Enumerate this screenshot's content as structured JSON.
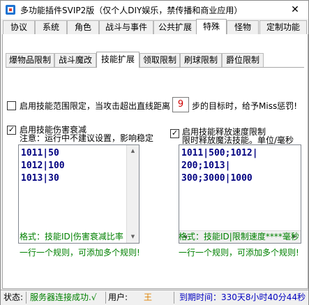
{
  "window": {
    "title": "多功能插件SVIP2版（仅个人DIY娱乐，禁传播和商业应用）",
    "close_label": "✕"
  },
  "main_tabs": [
    {
      "label": "协议"
    },
    {
      "label": "系统"
    },
    {
      "label": "角色"
    },
    {
      "label": "战斗与事件"
    },
    {
      "label": "公共扩展"
    },
    {
      "label": "特殊"
    },
    {
      "label": "怪物"
    },
    {
      "label": "定制功能"
    }
  ],
  "main_tab_active": "特殊",
  "sub_tabs": [
    {
      "label": "爆物品限制"
    },
    {
      "label": "战斗魔改"
    },
    {
      "label": "技能扩展"
    },
    {
      "label": "领取限制"
    },
    {
      "label": "刷球限制"
    },
    {
      "label": "爵位限制"
    }
  ],
  "sub_tab_active": "技能扩展",
  "range_limit": {
    "label_before": "启用技能范围限定，当攻击超出直线距离",
    "value": "9",
    "label_after": "步的目标时，给予Miss惩罚!",
    "checked": false
  },
  "damage_decay": {
    "label": "启用技能伤害衰减",
    "checked": true,
    "note": "注意：运行中不建议设置，影响稳定",
    "text": "1011|50\n1012|100\n1013|30",
    "format": "格式：技能ID|伤害衰减比率",
    "hint": "一行一个规则，可添加多个规则!"
  },
  "speed_limit": {
    "label": "启用技能释放速度限制",
    "checked": true,
    "note": "限时释放魔法技能。单位/毫秒",
    "text": "1011|500;1012|\n200;1013|\n300;3000|1000",
    "format": "格式：技能ID|限制速度****毫秒",
    "hint": "一行一个规则，可添加多个规则!"
  },
  "status": {
    "state_label": "状态:",
    "state_value": "服务器连接成功.√",
    "user_label": "用户:",
    "user_value": "王",
    "expire": "到期时间：330天8小时40分44秒"
  },
  "colors": {
    "accent_green": "#008000",
    "memo_text": "#000080",
    "user_orange": "#e08000",
    "expire_blue": "#0000c0",
    "limit_red": "#d00000"
  },
  "icons": {
    "app": "app-icon",
    "close": "close-icon"
  }
}
